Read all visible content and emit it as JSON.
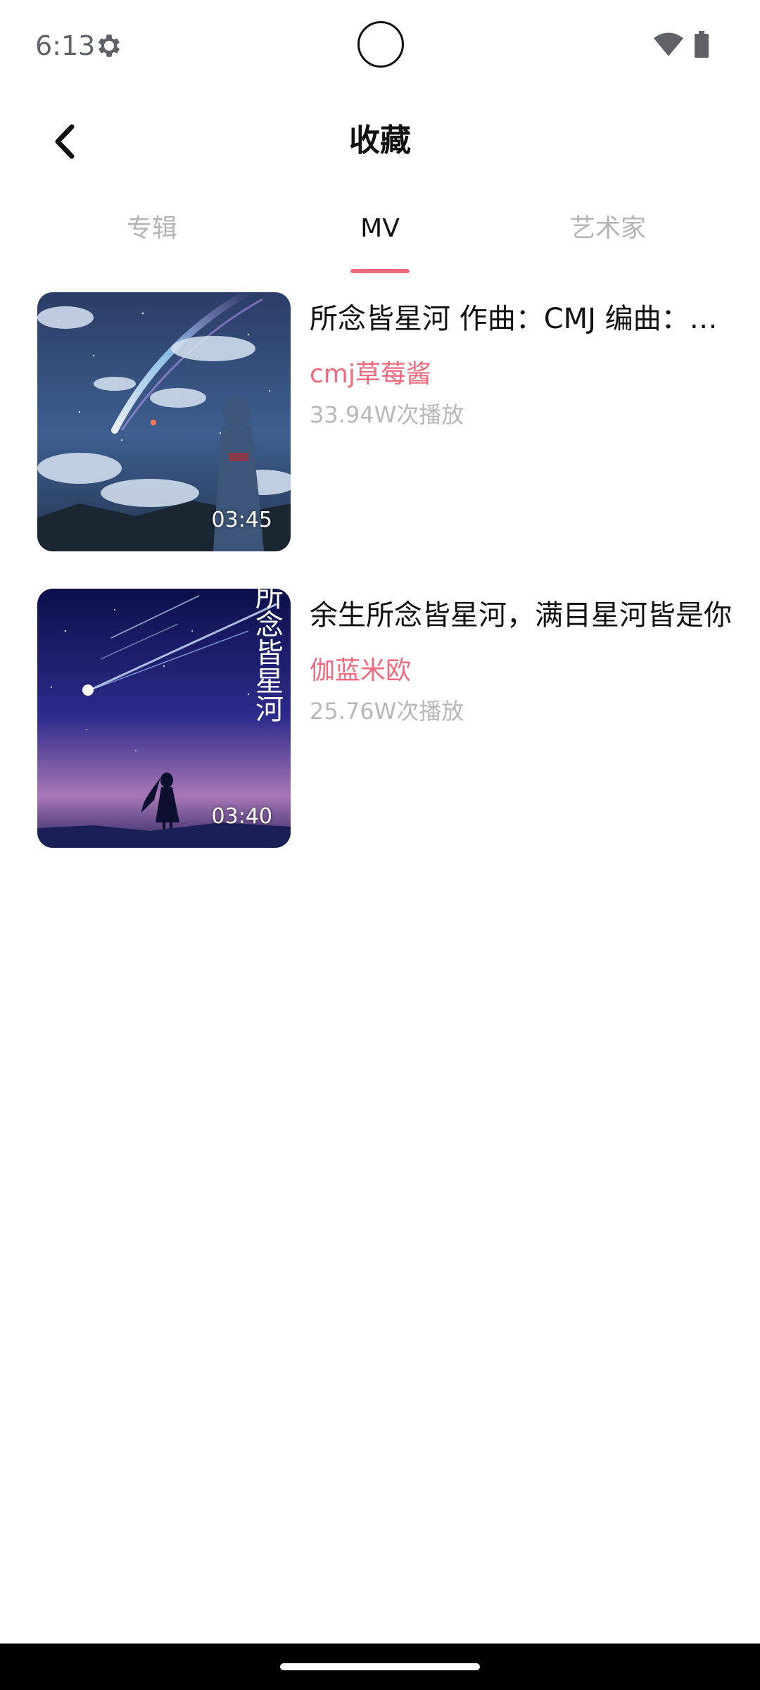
{
  "status_bar": {
    "time": "6:13"
  },
  "header": {
    "title": "收藏"
  },
  "tabs": [
    {
      "label": "专辑",
      "active": false
    },
    {
      "label": "MV",
      "active": true
    },
    {
      "label": "艺术家",
      "active": false
    }
  ],
  "mv_list": [
    {
      "title": "所念皆星河 作曲：CMJ 编曲：CMJ",
      "artist": "cmj草莓酱",
      "plays": "33.94W次播放",
      "duration": "03:45"
    },
    {
      "title": "余生所念皆星河，满目星河皆是你",
      "artist": "伽蓝米欧",
      "plays": "25.76W次播放",
      "duration": "03:40",
      "cover_text": "所念皆星河"
    }
  ],
  "colors": {
    "accent": "#f06a7e",
    "text_primary": "#111111",
    "text_secondary": "#b8b8b8"
  }
}
